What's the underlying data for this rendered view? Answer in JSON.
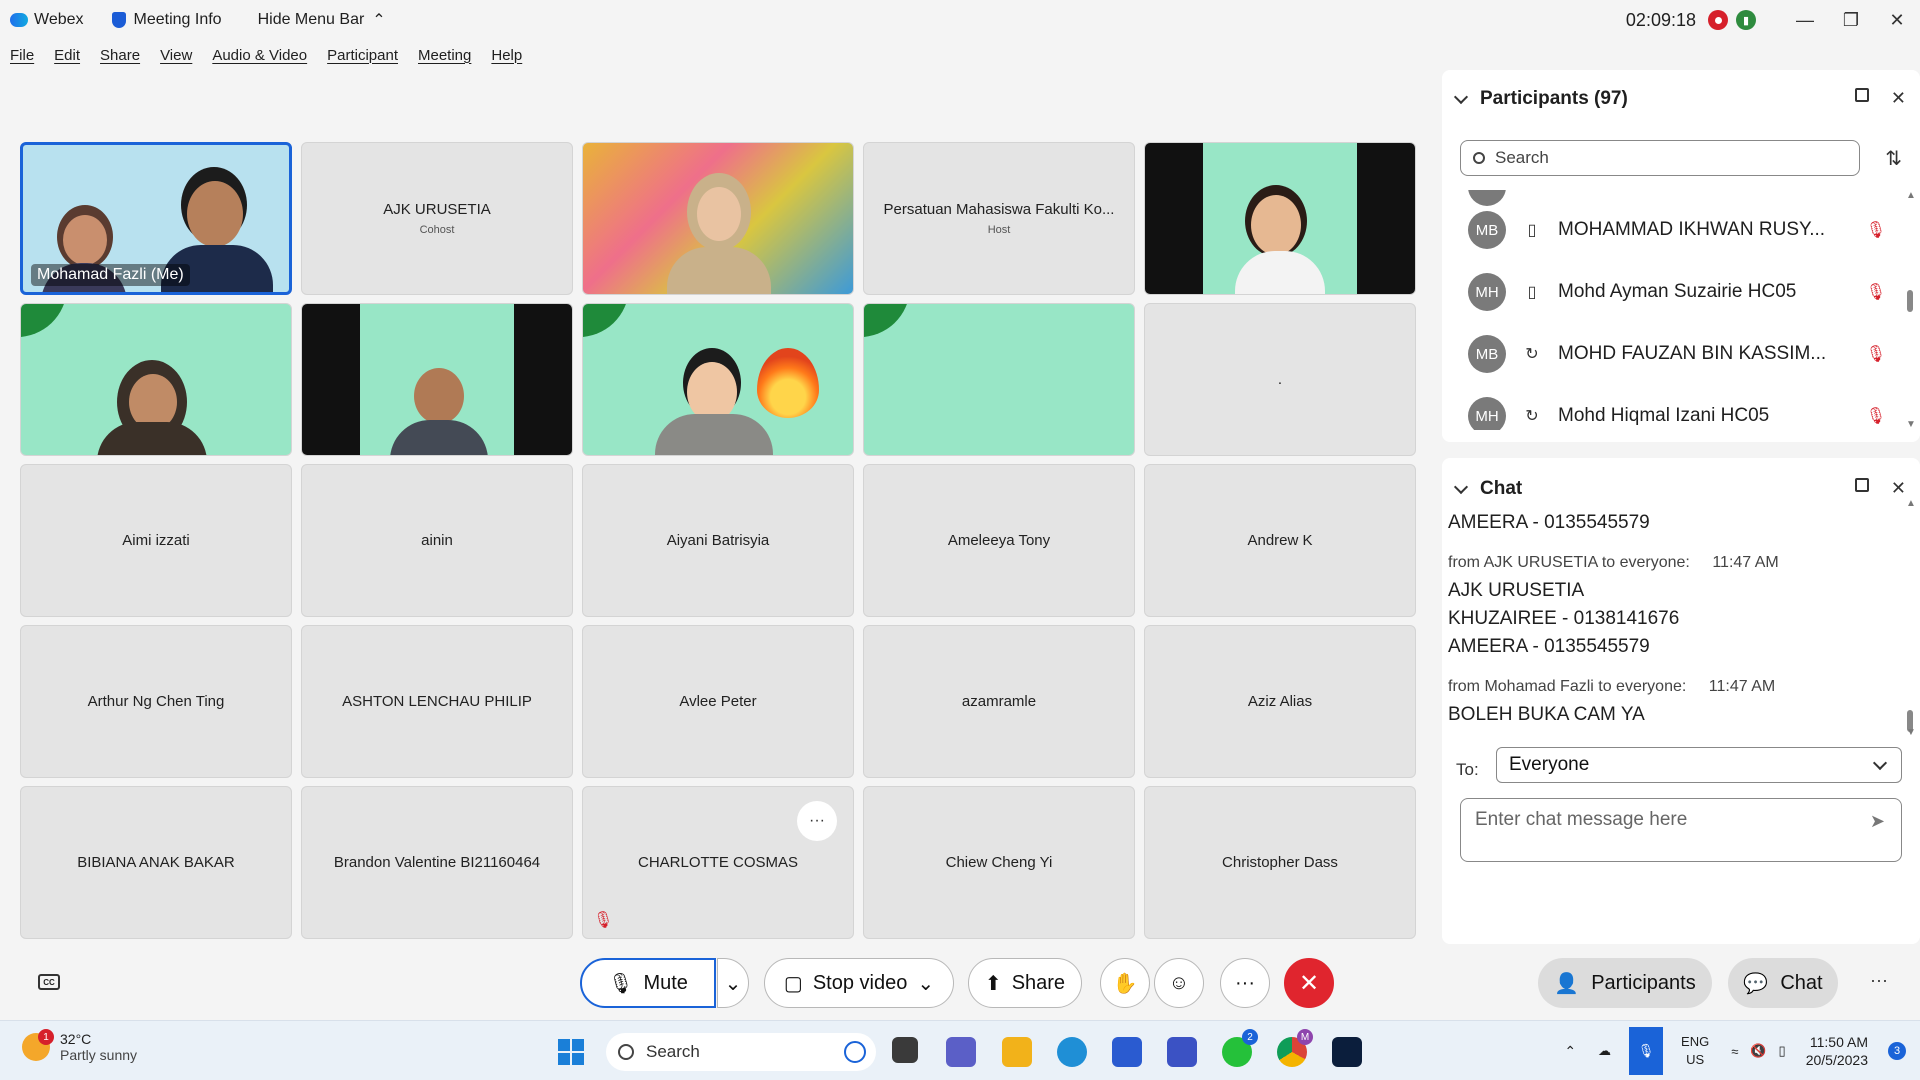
{
  "titlebar": {
    "app_name": "Webex",
    "meeting_info": "Meeting Info",
    "hide_menu": "Hide Menu Bar",
    "timer": "02:09:18"
  },
  "menu": [
    "File",
    "Edit",
    "Share",
    "View",
    "Audio & Video",
    "Participant",
    "Meeting",
    "Help"
  ],
  "grid": {
    "me_name": "Mohamad Fazli (Me)",
    "tiles": [
      {
        "name": "AJK URUSETIA",
        "role": "Cohost"
      },
      {
        "name": "Persatuan Mahasiswa Fakulti Ko...",
        "role": "Host"
      },
      {
        "name": "."
      },
      {
        "name": "Aimi izzati"
      },
      {
        "name": "ainin"
      },
      {
        "name": "Aiyani Batrisyia"
      },
      {
        "name": "Ameleeya Tony"
      },
      {
        "name": "Andrew K"
      },
      {
        "name": "Arthur Ng Chen Ting"
      },
      {
        "name": "ASHTON LENCHAU PHILIP"
      },
      {
        "name": "Avlee Peter"
      },
      {
        "name": "azamramle"
      },
      {
        "name": "Aziz Alias"
      },
      {
        "name": "BIBIANA ANAK BAKAR"
      },
      {
        "name": "Brandon Valentine BI21160464"
      },
      {
        "name": "CHARLOTTE COSMAS"
      },
      {
        "name": "Chiew Cheng Yi"
      },
      {
        "name": "Christopher Dass"
      }
    ]
  },
  "toolbar": {
    "mute": "Mute",
    "stop_video": "Stop video",
    "share": "Share",
    "more": "···"
  },
  "participants_panel": {
    "title": "Participants (97)",
    "search_placeholder": "Search",
    "rows": [
      {
        "initials": "MB",
        "name": "MOHAMMAD IKHWAN RUSY..."
      },
      {
        "initials": "MH",
        "name": "Mohd Ayman Suzairie HC05"
      },
      {
        "initials": "MB",
        "name": "MOHD FAUZAN BIN KASSIM..."
      },
      {
        "initials": "MH",
        "name": "Mohd Hiqmal Izani HC05"
      }
    ]
  },
  "chat_panel": {
    "title": "Chat",
    "lines": [
      {
        "text": "AMEERA - 0135545579",
        "kind": "msg"
      },
      {
        "text": "from AJK URUSETIA to everyone:",
        "time": "11:47 AM",
        "kind": "meta"
      },
      {
        "text": "AJK URUSETIA",
        "kind": "msg"
      },
      {
        "text": "KHUZAIREE - 0138141676",
        "kind": "msg"
      },
      {
        "text": "AMEERA - 0135545579",
        "kind": "msg"
      },
      {
        "text": "from Mohamad Fazli to everyone:",
        "time": "11:47 AM",
        "kind": "meta"
      },
      {
        "text": "BOLEH BUKA CAM YA",
        "kind": "msg"
      }
    ],
    "to_label": "To:",
    "to_value": "Everyone",
    "input_placeholder": "Enter chat message here"
  },
  "bottom_right": {
    "participants": "Participants",
    "chat": "Chat"
  },
  "taskbar": {
    "weather_temp": "32°C",
    "weather_desc": "Partly sunny",
    "weather_badge": "1",
    "search": "Search",
    "lang_top": "ENG",
    "lang_bottom": "US",
    "time": "11:50 AM",
    "date": "20/5/2023",
    "notif_count": "3",
    "whatsapp_badge": "2",
    "chrome_badge": "M"
  },
  "colors": {
    "accent": "#1a63d8",
    "leave": "#e0252e",
    "muted": "#d6202b",
    "video_bg": "#98e6c6"
  }
}
